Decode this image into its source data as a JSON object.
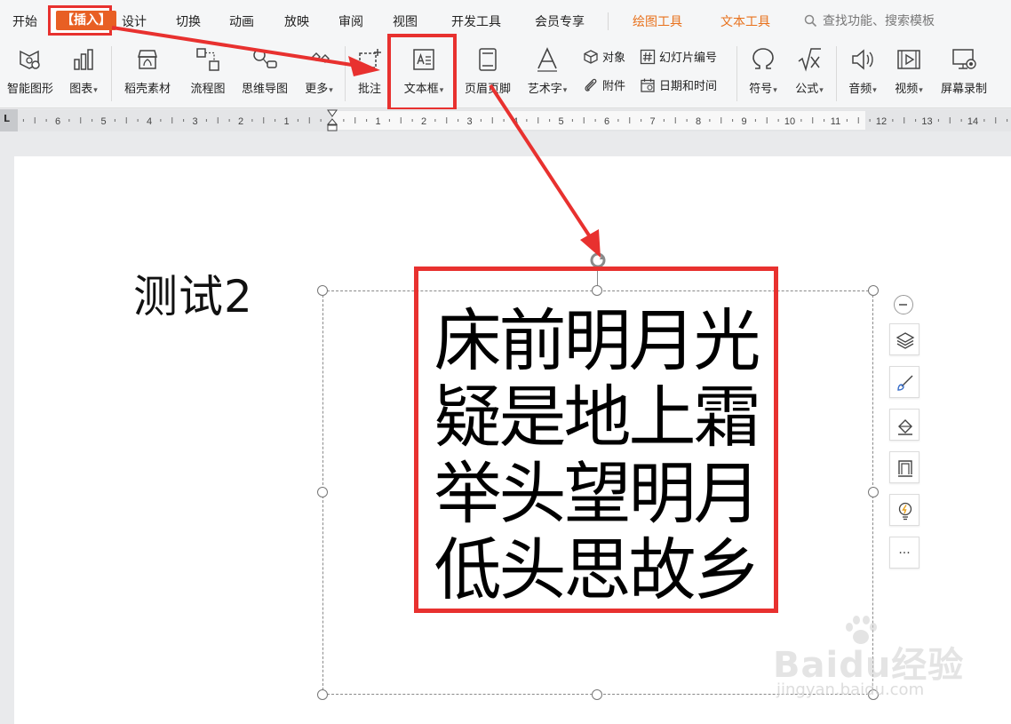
{
  "menu": {
    "tabs": [
      "开始",
      "插入",
      "设计",
      "切换",
      "动画",
      "放映",
      "审阅",
      "视图",
      "开发工具",
      "会员专享"
    ],
    "context_tabs": [
      "绘图工具",
      "文本工具"
    ],
    "search_placeholder": "查找功能、搜索模板",
    "active_tab": "插入"
  },
  "ribbon": {
    "smart_graphic": "智能图形",
    "chart": "图表",
    "docer_material": "稻壳素材",
    "flowchart": "流程图",
    "mindmap": "思维导图",
    "more": "更多",
    "comment": "批注",
    "textbox": "文本框",
    "header_footer": "页眉页脚",
    "wordart": "艺术字",
    "object": "对象",
    "slide_number": "幻灯片编号",
    "attachment": "附件",
    "date_time": "日期和时间",
    "symbol": "符号",
    "formula": "公式",
    "audio": "音频",
    "video": "视频",
    "screen_record": "屏幕录制"
  },
  "ruler": {
    "corner": "L",
    "labels": [
      "6",
      "5",
      "4",
      "3",
      "2",
      "1",
      "1",
      "2",
      "3",
      "4",
      "5",
      "6",
      "7",
      "8",
      "9",
      "10",
      "11",
      "12",
      "13",
      "14"
    ]
  },
  "slide": {
    "title": "测试2",
    "poem": [
      "床前明月光",
      "疑是地上霜",
      "举头望明月",
      "低头思故乡"
    ]
  },
  "float_toolbar": {
    "more": "···"
  },
  "watermark": {
    "main": "Baidu经验",
    "sub": "jingyan.baidu.com"
  },
  "colors": {
    "highlight_red": "#e8312f",
    "insert_tab_orange": "#e85f24",
    "context_tab_orange": "#e8711c"
  }
}
